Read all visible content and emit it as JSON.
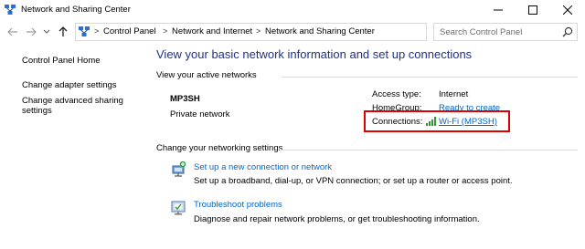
{
  "window": {
    "title": "Network and Sharing Center"
  },
  "address_bar": {
    "breadcrumbs": [
      "Control Panel",
      "Network and Internet",
      "Network and Sharing Center"
    ],
    "separator": ">",
    "search_placeholder": "Search Control Panel"
  },
  "left_pane": {
    "links": [
      "Control Panel Home",
      "Change adapter settings",
      "Change advanced sharing",
      "settings"
    ]
  },
  "main": {
    "heading": "View your basic network information and set up connections",
    "active_networks_label": "View your active networks",
    "network": {
      "name": "MP3SH",
      "category": "Private network",
      "properties": {
        "access_type_label": "Access type:",
        "access_type_value": "Internet",
        "homegroup_label": "HomeGroup:",
        "homegroup_value": "Ready to create",
        "connections_label": "Connections:",
        "connections_value": "Wi-Fi (MP3SH)"
      }
    },
    "change_settings_label": "Change your networking settings",
    "tasks": [
      {
        "title": "Set up a new connection or network",
        "description": "Set up a broadband, dial-up, or VPN connection; or set up a router or access point."
      },
      {
        "title": "Troubleshoot problems",
        "description": "Diagnose and repair network problems, or get troubleshooting information."
      }
    ]
  },
  "colors": {
    "heading": "#1e3287",
    "link": "#0066cc",
    "highlight": "#e00000"
  }
}
